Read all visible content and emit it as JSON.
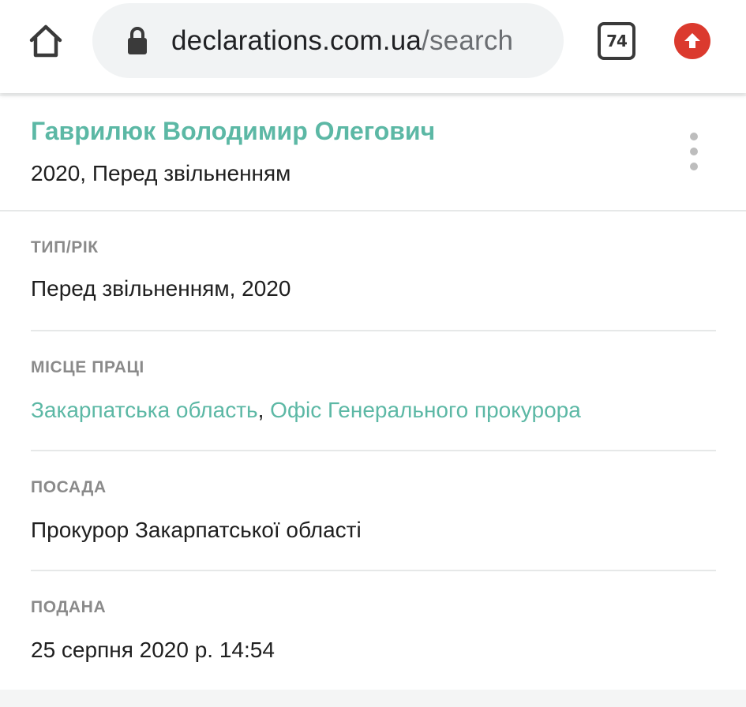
{
  "browser": {
    "url_domain": "declarations.com.ua",
    "url_path": "/search",
    "tab_count": "74",
    "icons": {
      "home": "home-icon",
      "lock": "lock-icon",
      "tabs": "tabs-counter-icon",
      "update": "update-arrow-icon"
    },
    "update_color": "#db3a2e"
  },
  "declaration": {
    "name": "Гаврилюк Володимир Олегович",
    "subtitle": "2020, Перед звільненням",
    "menu_icon": "more-vert-icon",
    "accent_color": "#5cb8a5",
    "fields": [
      {
        "label": "ТИП/РІК",
        "value": "Перед звільненням, 2020"
      },
      {
        "label": "МІСЦЕ ПРАЦІ",
        "links": [
          "Закарпатська область",
          "Офіс Генерального прокурора"
        ],
        "separator": ", "
      },
      {
        "label": "ПОСАДА",
        "value": "Прокурор Закарпатської області"
      },
      {
        "label": "ПОДАНА",
        "value": "25 серпня 2020 р. 14:54"
      }
    ]
  }
}
